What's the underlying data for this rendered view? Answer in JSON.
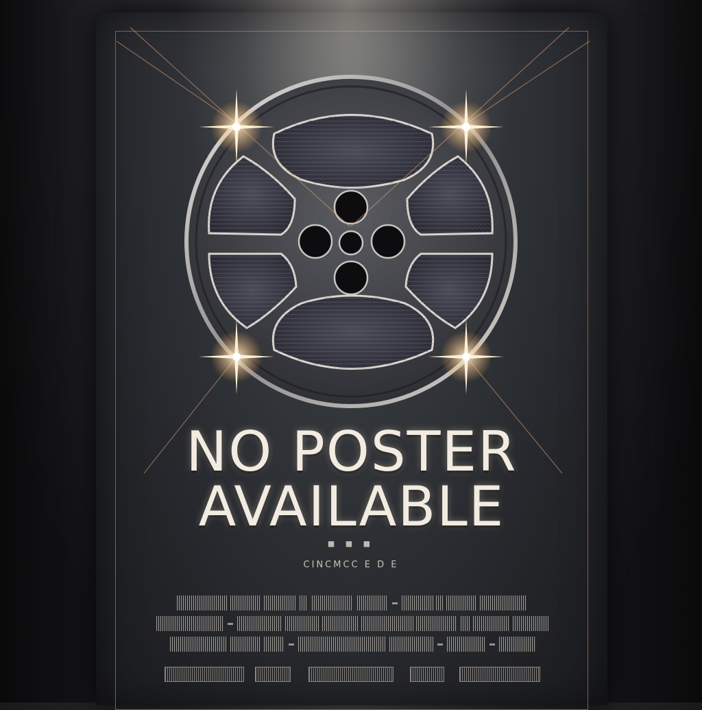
{
  "poster": {
    "headline_line1": "NO POSTER",
    "headline_line2": "AVAILABLE",
    "dots": "■ ■ ■",
    "tagline": "CINCMCC  E  D  E"
  },
  "icons": {
    "main": "film-reel-icon",
    "flares": "lens-flare-icon"
  },
  "colors": {
    "background": "#1c1d21",
    "frame": "#9a6a4e",
    "text": "#f1ebe2",
    "flare": "#ffd9a0"
  }
}
